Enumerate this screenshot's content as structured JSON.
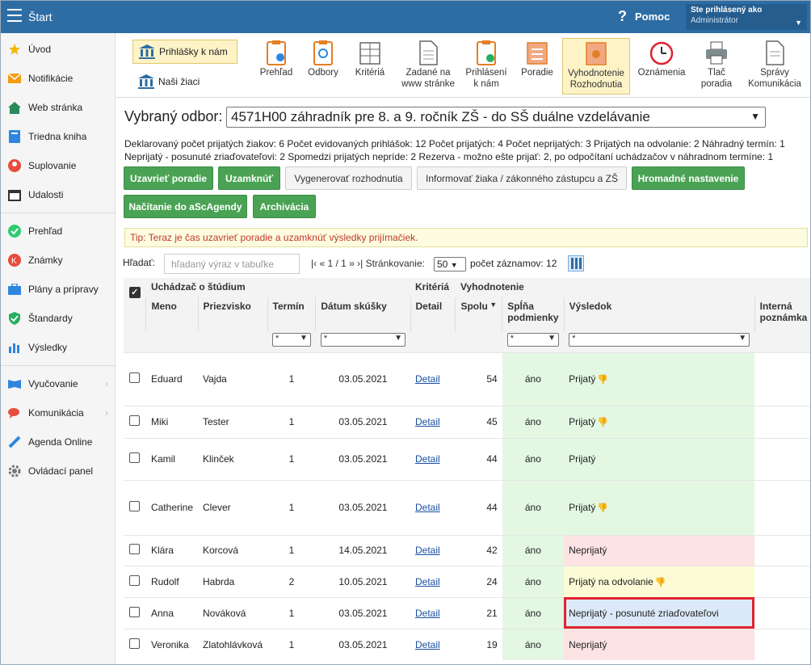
{
  "topbar": {
    "title": "Štart",
    "help": "Pomoc",
    "user_line1": "Ste prihlásený ako",
    "user_line2": "Administrátor"
  },
  "sidebar": {
    "items": [
      {
        "label": "Úvod",
        "icon": "star-icon"
      },
      {
        "label": "Notifikácie",
        "icon": "envelope-icon"
      },
      {
        "label": "Web stránka",
        "icon": "home-icon"
      },
      {
        "label": "Triedna kniha",
        "icon": "book-icon"
      },
      {
        "label": "Suplovanie",
        "icon": "person-icon"
      },
      {
        "label": "Udalosti",
        "icon": "calendar-icon"
      },
      {
        "label": "Prehľad",
        "icon": "check-circle-icon"
      },
      {
        "label": "Známky",
        "icon": "grade-icon"
      },
      {
        "label": "Plány a prípravy",
        "icon": "briefcase-icon"
      },
      {
        "label": "Štandardy",
        "icon": "shield-icon"
      },
      {
        "label": "Výsledky",
        "icon": "bar-chart-icon"
      },
      {
        "label": "Vyučovanie",
        "icon": "open-book-icon"
      },
      {
        "label": "Komunikácia",
        "icon": "chat-icon"
      },
      {
        "label": "Agenda Online",
        "icon": "pen-icon"
      },
      {
        "label": "Ovládací panel",
        "icon": "gear-icon"
      }
    ]
  },
  "toolbar": {
    "applications": "Prihlášky k nám",
    "our_students": "Naši žiaci",
    "buttons": [
      "Prehľad",
      "Odbory",
      "Kritériá",
      "Zadané na\nwww stránke",
      "Prihlásení\nk nám",
      "Poradie",
      "Vyhodnotenie\nRozhodnutia",
      "Oznámenia",
      "Tlač\nporadia",
      "Správy\nKomunikácia"
    ]
  },
  "odbor": {
    "label": "Vybraný odbor:",
    "value": "4571H00 záhradník pre 8. a 9. ročník ZŠ - do SŠ duálne vzdelávanie"
  },
  "stats": {
    "line1": "Deklarovaný počet prijatých žiakov: 6 Počet evidovaných prihlášok: 12 Počet prijatých: 4 Počet neprijatých: 3 Prijatých na odvolanie: 2 Náhradný termín: 1",
    "line2": "Neprijatý - posunuté zriaďovateľovi: 2 Spomedzi prijatých nepríde: 2 Rezerva - možno ešte prijať: 2, po odpočítaní uchádzačov v náhradnom termíne: 1"
  },
  "actions": {
    "close_order": "Uzavrieť poradie",
    "lock": "Uzamknúť",
    "generate": "Vygenerovať rozhodnutia",
    "inform": "Informovať žiaka / zákonného zástupcu a ZŠ",
    "bulk": "Hromadné nastavenie",
    "load": "Načítanie do aScAgendy",
    "archive": "Archivácia"
  },
  "tip": "Tip: Teraz je čas uzavrieť poradie a uzamknúť výsledky prijímačiek.",
  "search": {
    "label": "Hľadať:",
    "placeholder": "hľadaný výraz v tabuľke",
    "pager": "|‹ « 1 / 1 » ›|  Stránkovanie:",
    "per_page": "50",
    "count": "počet záznamov: 12"
  },
  "table": {
    "groups": {
      "applicant": "Uchádzač o štúdium",
      "criteria": "Kritériá",
      "evaluation": "Vyhodnotenie"
    },
    "columns": {
      "name": "Meno",
      "surname": "Priezvisko",
      "term": "Termín",
      "date": "Dátum skúšky",
      "detail": "Detail",
      "total": "Spolu",
      "meets": "Spĺňa podmienky",
      "result": "Výsledok",
      "note": "Interná poznámka"
    },
    "filter_all": "*",
    "rows": [
      {
        "name": "Eduard",
        "surname": "Vajda",
        "term": "1",
        "date": "03.05.2021",
        "detail": "Detail",
        "total": "54",
        "meets": "áno",
        "result": "Prijatý",
        "thumb": true,
        "color": "green"
      },
      {
        "name": "Miki",
        "surname": "Tester",
        "term": "1",
        "date": "03.05.2021",
        "detail": "Detail",
        "total": "45",
        "meets": "áno",
        "result": "Prijatý",
        "thumb": true,
        "color": "green"
      },
      {
        "name": "Kamil",
        "surname": "Klinček",
        "term": "1",
        "date": "03.05.2021",
        "detail": "Detail",
        "total": "44",
        "meets": "áno",
        "result": "Prijatý",
        "thumb": false,
        "color": "green"
      },
      {
        "name": "Catherine",
        "surname": "Clever",
        "term": "1",
        "date": "03.05.2021",
        "detail": "Detail",
        "total": "44",
        "meets": "áno",
        "result": "Prijatý",
        "thumb": true,
        "color": "green"
      },
      {
        "name": "Klára",
        "surname": "Korcová",
        "term": "1",
        "date": "14.05.2021",
        "detail": "Detail",
        "total": "42",
        "meets": "áno",
        "result": "Neprijatý",
        "thumb": false,
        "color": "red"
      },
      {
        "name": "Rudolf",
        "surname": "Habrda",
        "term": "2",
        "date": "10.05.2021",
        "detail": "Detail",
        "total": "24",
        "meets": "áno",
        "result": "Prijatý na odvolanie",
        "thumb": true,
        "color": "yellow"
      },
      {
        "name": "Anna",
        "surname": "Nováková",
        "term": "1",
        "date": "03.05.2021",
        "detail": "Detail",
        "total": "21",
        "meets": "áno",
        "result": "Neprijatý - posunuté zriaďovateľovi",
        "thumb": false,
        "color": "blue"
      },
      {
        "name": "Veronika",
        "surname": "Zlatohlávková",
        "term": "1",
        "date": "03.05.2021",
        "detail": "Detail",
        "total": "19",
        "meets": "áno",
        "result": "Neprijatý",
        "thumb": false,
        "color": "red"
      }
    ]
  }
}
